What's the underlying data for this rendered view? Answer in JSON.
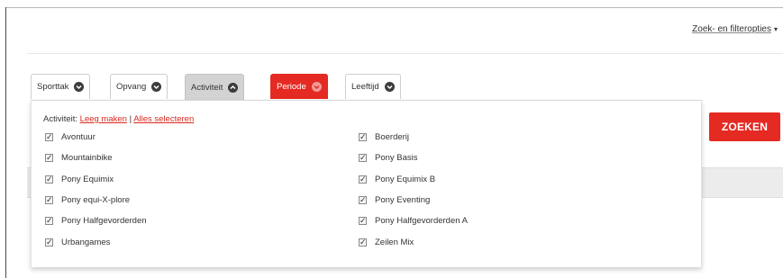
{
  "header": {
    "filter_link": "Zoek- en filteropties",
    "caret": "▾"
  },
  "tabs": [
    {
      "label": "Sporttak",
      "icon": "chevron-down-icon",
      "state": "normal"
    },
    {
      "label": "Opvang",
      "icon": "chevron-down-icon",
      "state": "normal"
    },
    {
      "label": "Activiteit",
      "icon": "chevron-up-icon",
      "state": "active"
    },
    {
      "label": "Periode",
      "icon": "chevron-down-icon",
      "state": "highlighted"
    },
    {
      "label": "Leeftijd",
      "icon": "chevron-down-icon",
      "state": "normal"
    }
  ],
  "search_button": "ZOEKEN",
  "dropdown": {
    "prefix": "Activiteit:",
    "clear_label": "Leeg maken",
    "separator": "|",
    "select_all_label": "Alles selecteren",
    "check_glyph": "✓",
    "left_options": [
      "Avontuur",
      "Mountainbike",
      "Pony Equimix",
      "Pony equi-X-plore",
      "Pony Halfgevorderden",
      "Urbangames"
    ],
    "right_options": [
      "Boerderij",
      "Pony Basis",
      "Pony Equimix B",
      "Pony Eventing",
      "Pony Halfgevorderden A",
      "Zeilen Mix"
    ]
  },
  "colors": {
    "accent_red": "#e42a22",
    "active_tab_gray": "#d3d3d3"
  }
}
